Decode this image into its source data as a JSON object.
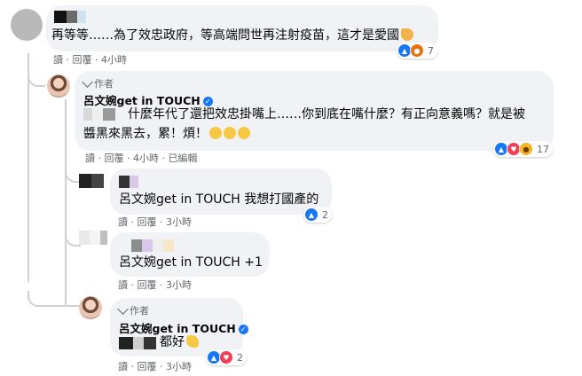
{
  "comment1": {
    "text": "再等等……為了效忠政府，等高端問世再注射疫苗，這才是愛國",
    "emoji": "flexed-biceps-icon",
    "actions": {
      "read": "讀",
      "reply": "回覆",
      "time": "4小時"
    },
    "reactions": {
      "icons": [
        "like-icon",
        "angry-icon"
      ],
      "count": "7"
    }
  },
  "reply1": {
    "author_badge": "作者",
    "name": "呂文婉get in TOUCH",
    "text_line1": "什麼年代了還把效忠掛嘴上……你到底在嘴什麼？有正向意義嗎？就是被",
    "text_line2": "醬黑來黑去，累！煩！",
    "emojis": [
      "sad-face-icon",
      "sad-face-icon",
      "sad-face-icon"
    ],
    "actions": {
      "read": "讀",
      "reply": "回覆",
      "time": "4小時",
      "edited": "已編輯"
    },
    "reactions": {
      "icons": [
        "like-icon",
        "love-icon",
        "haha-icon"
      ],
      "count": "17"
    }
  },
  "reply2": {
    "text": "呂文婉get in TOUCH 我想打國產的",
    "actions": {
      "read": "讀",
      "reply": "回覆",
      "time": "3小時"
    },
    "reactions": {
      "icons": [
        "like-icon"
      ],
      "count": "2"
    }
  },
  "reply3": {
    "text": "呂文婉get in TOUCH +1",
    "actions": {
      "read": "讀",
      "reply": "回覆",
      "time": "3小時"
    }
  },
  "reply4": {
    "author_badge": "作者",
    "name": "呂文婉get in TOUCH",
    "text": "都好",
    "emoji": "thumbs-up-icon",
    "actions": {
      "read": "讀",
      "reply": "回覆",
      "time": "3小時"
    },
    "reactions": {
      "icons": [
        "like-icon",
        "love-icon"
      ],
      "count": "2"
    }
  },
  "colors": {
    "bubble": "#f0f2f5",
    "meta": "#65676b",
    "like": "#1877f2",
    "love": "#f33e58",
    "angry": "#e9710f",
    "haha": "#f7b125"
  }
}
